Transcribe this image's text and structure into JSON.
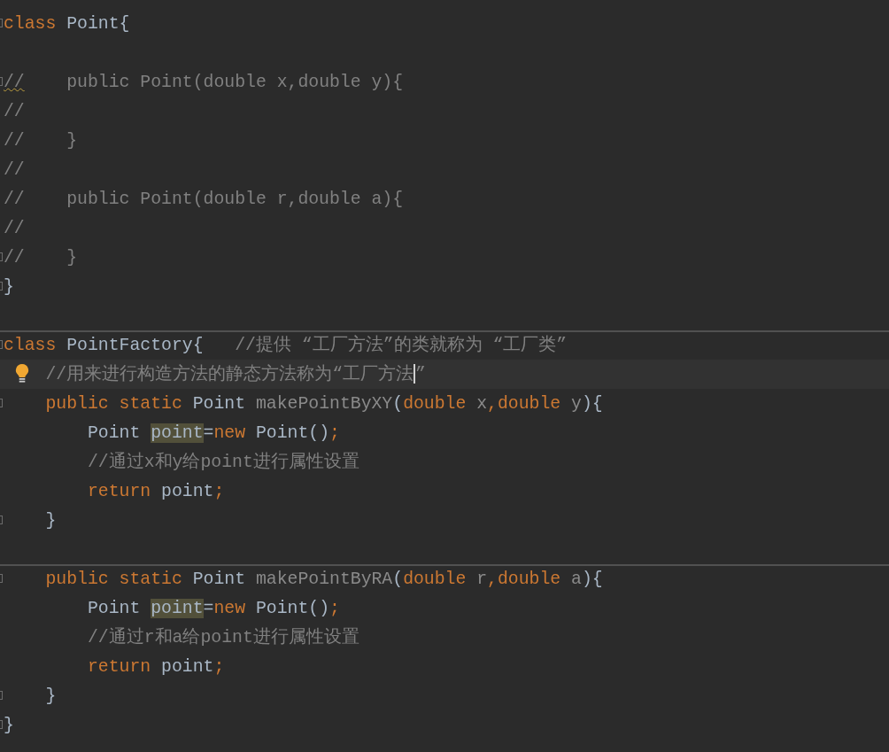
{
  "editor": {
    "lines": [
      {
        "fold": true,
        "tokens": [
          {
            "text": "class",
            "kind": "keyword"
          },
          {
            "text": " Point{",
            "kind": "plain"
          }
        ]
      },
      {
        "fold": true,
        "gap_before": true,
        "tokens": [
          {
            "text": "//",
            "kind": "comment",
            "warning": true
          },
          {
            "text": "    public Point(double x,double y){",
            "kind": "comment"
          }
        ]
      },
      {
        "tokens": [
          {
            "text": "//",
            "kind": "comment"
          }
        ]
      },
      {
        "tokens": [
          {
            "text": "//    }",
            "kind": "comment"
          }
        ]
      },
      {
        "tokens": [
          {
            "text": "//",
            "kind": "comment"
          }
        ]
      },
      {
        "tokens": [
          {
            "text": "//    public Point(double r,double a){",
            "kind": "comment"
          }
        ]
      },
      {
        "tokens": [
          {
            "text": "//",
            "kind": "comment"
          }
        ]
      },
      {
        "fold": true,
        "tokens": [
          {
            "text": "//    }",
            "kind": "comment"
          }
        ]
      },
      {
        "fold": true,
        "tokens": [
          {
            "text": "}",
            "kind": "plain"
          }
        ]
      },
      {
        "fold": true,
        "gap_before": true,
        "separator_above": true,
        "tokens": [
          {
            "text": "class",
            "kind": "keyword"
          },
          {
            "text": " PointFactory{",
            "kind": "plain"
          },
          {
            "text": "   //提供 “工厂方法”的类就称为 “工厂类”",
            "kind": "comment"
          }
        ]
      },
      {
        "current": true,
        "bulb": true,
        "tokens": [
          {
            "text": "    //用来进行构造方法的静态方法称为“工厂方法",
            "kind": "comment",
            "caret_after": true
          },
          {
            "text": "”",
            "kind": "comment"
          }
        ]
      },
      {
        "fold": true,
        "tokens": [
          {
            "text": "    public static",
            "kind": "keyword"
          },
          {
            "text": " Point ",
            "kind": "plain"
          },
          {
            "text": "makePointByXY",
            "kind": "unused"
          },
          {
            "text": "(",
            "kind": "plain"
          },
          {
            "text": "double",
            "kind": "keyword"
          },
          {
            "text": " x",
            "kind": "unused"
          },
          {
            "text": ",",
            "kind": "keyword"
          },
          {
            "text": "double",
            "kind": "keyword"
          },
          {
            "text": " y",
            "kind": "unused"
          },
          {
            "text": "){",
            "kind": "plain"
          }
        ]
      },
      {
        "tokens": [
          {
            "text": "        Point ",
            "kind": "plain"
          },
          {
            "text": "point",
            "kind": "plain",
            "highlighted": true
          },
          {
            "text": "=",
            "kind": "plain"
          },
          {
            "text": "new",
            "kind": "keyword"
          },
          {
            "text": " Point()",
            "kind": "plain"
          },
          {
            "text": ";",
            "kind": "keyword"
          }
        ]
      },
      {
        "tokens": [
          {
            "text": "        //通过x和y给point进行属性设置",
            "kind": "comment"
          }
        ]
      },
      {
        "tokens": [
          {
            "text": "        return",
            "kind": "keyword"
          },
          {
            "text": " point",
            "kind": "plain"
          },
          {
            "text": ";",
            "kind": "keyword"
          }
        ]
      },
      {
        "fold": true,
        "tokens": [
          {
            "text": "    }",
            "kind": "plain"
          }
        ]
      },
      {
        "fold": true,
        "gap_before": true,
        "separator_above": true,
        "tokens": [
          {
            "text": "    public static",
            "kind": "keyword"
          },
          {
            "text": " Point ",
            "kind": "plain"
          },
          {
            "text": "makePointByRA",
            "kind": "unused"
          },
          {
            "text": "(",
            "kind": "plain"
          },
          {
            "text": "double",
            "kind": "keyword"
          },
          {
            "text": " r",
            "kind": "unused"
          },
          {
            "text": ",",
            "kind": "keyword"
          },
          {
            "text": "double",
            "kind": "keyword"
          },
          {
            "text": " a",
            "kind": "unused"
          },
          {
            "text": "){",
            "kind": "plain"
          }
        ]
      },
      {
        "tokens": [
          {
            "text": "        Point ",
            "kind": "plain"
          },
          {
            "text": "point",
            "kind": "plain",
            "highlighted": true
          },
          {
            "text": "=",
            "kind": "plain"
          },
          {
            "text": "new",
            "kind": "keyword"
          },
          {
            "text": " Point()",
            "kind": "plain"
          },
          {
            "text": ";",
            "kind": "keyword"
          }
        ]
      },
      {
        "tokens": [
          {
            "text": "        //通过r和a给point进行属性设置",
            "kind": "comment"
          }
        ]
      },
      {
        "tokens": [
          {
            "text": "        return",
            "kind": "keyword"
          },
          {
            "text": " point",
            "kind": "plain"
          },
          {
            "text": ";",
            "kind": "keyword"
          }
        ]
      },
      {
        "fold": true,
        "tokens": [
          {
            "text": "    }",
            "kind": "plain"
          }
        ]
      },
      {
        "fold": true,
        "tokens": [
          {
            "text": "}",
            "kind": "plain"
          }
        ]
      }
    ]
  }
}
